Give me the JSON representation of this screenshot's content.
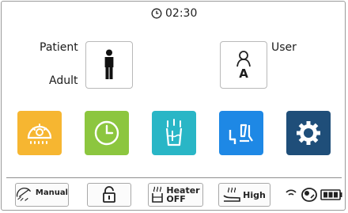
{
  "status": {
    "timer_value": "02:30"
  },
  "profile": {
    "patient_label": "Patient",
    "patient_type": "Adult",
    "user_label": "User",
    "user_letter": "A"
  },
  "tiles": [
    {
      "name": "lamp",
      "icon": "lamp-icon",
      "color": "#f6b631"
    },
    {
      "name": "timer",
      "icon": "clock-icon",
      "color": "#8cc63f"
    },
    {
      "name": "cup-filler",
      "icon": "cup-filler-icon",
      "color": "#29b6c6"
    },
    {
      "name": "chair-position",
      "icon": "chair-icon",
      "color": "#1e88e5"
    },
    {
      "name": "settings",
      "icon": "gear-icon",
      "color": "#1f4e79"
    }
  ],
  "statusbar": {
    "lamp_mode": "Manual",
    "heater_label": "Heater",
    "heater_state": "OFF",
    "level_label": "High"
  }
}
